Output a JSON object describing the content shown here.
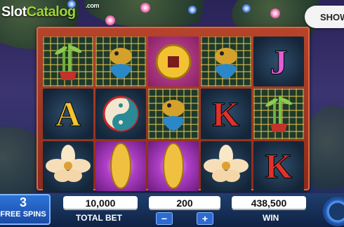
{
  "logo": {
    "slot": "Slot",
    "catalog": "Catalog",
    "com": ".com"
  },
  "show_button": "SHOW",
  "reels": [
    [
      "bamboo",
      "goldfish",
      "gold-coin",
      "goldfish",
      "J"
    ],
    [
      "A",
      "yin-yang",
      "goldfish",
      "K",
      "bamboo"
    ],
    [
      "lotus",
      "gold-ingot",
      "gold-ingot",
      "lotus",
      "K"
    ]
  ],
  "free_spins": {
    "count": "3",
    "label": "FREE SPINS"
  },
  "total_bet": {
    "value": "10,000",
    "label": "TOTAL BET"
  },
  "lines": {
    "value": "200",
    "minus": "−",
    "plus": "+"
  },
  "win": {
    "value": "438,500",
    "label": "WIN"
  },
  "colors": {
    "letter_J": "#e25fd4",
    "letter_A": "#f4c233",
    "letter_K": "#e0312a",
    "accent": "#2d6ad2"
  }
}
